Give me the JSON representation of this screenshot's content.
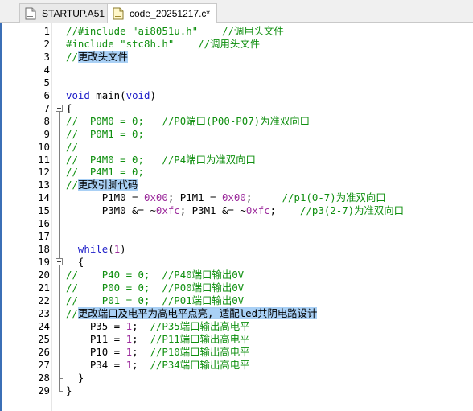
{
  "tabs": [
    {
      "label": "STARTUP.A51",
      "icon": "asm-file-icon",
      "active": false
    },
    {
      "label": "code_20251217.c*",
      "icon": "c-file-icon",
      "active": true
    }
  ],
  "lines": [
    {
      "n": "1",
      "code": "//#include \"ai8051u.h\"    //调用头文件"
    },
    {
      "n": "2",
      "code": "#include \"stc8h.h\"    //调用头文件"
    },
    {
      "n": "3",
      "code": "//更改头文件"
    },
    {
      "n": "4",
      "code": ""
    },
    {
      "n": "5",
      "code": ""
    },
    {
      "n": "6",
      "code": "void main(void)"
    },
    {
      "n": "7",
      "code": "{"
    },
    {
      "n": "8",
      "code": "//  P0M0 = 0;   //P0端口(P00-P07)为准双向口"
    },
    {
      "n": "9",
      "code": "//  P0M1 = 0;"
    },
    {
      "n": "10",
      "code": "//"
    },
    {
      "n": "11",
      "code": "//  P4M0 = 0;   //P4端口为准双向口"
    },
    {
      "n": "12",
      "code": "//  P4M1 = 0;"
    },
    {
      "n": "13",
      "code": "//更改引脚代码"
    },
    {
      "n": "14",
      "code": "      P1M0 = 0x00; P1M1 = 0x00;     //p1(0-7)为准双向口"
    },
    {
      "n": "15",
      "code": "      P3M0 &= ~0xfc; P3M1 &= ~0xfc;    //p3(2-7)为准双向口"
    },
    {
      "n": "16",
      "code": ""
    },
    {
      "n": "17",
      "code": ""
    },
    {
      "n": "18",
      "code": "  while(1)"
    },
    {
      "n": "19",
      "code": "  {"
    },
    {
      "n": "20",
      "code": "//    P40 = 0;  //P40端口输出0V"
    },
    {
      "n": "21",
      "code": "//    P00 = 0;  //P00端口输出0V"
    },
    {
      "n": "22",
      "code": "//    P01 = 0;  //P01端口输出0V"
    },
    {
      "n": "23",
      "code": "//更改端口及电平为高电平点亮, 适配led共阴电路设计"
    },
    {
      "n": "24",
      "code": "    P35 = 1;  //P35端口输出高电平"
    },
    {
      "n": "25",
      "code": "    P11 = 1;  //P11端口输出高电平"
    },
    {
      "n": "26",
      "code": "    P10 = 1;  //P10端口输出高电平"
    },
    {
      "n": "27",
      "code": "    P34 = 1;  //P34端口输出高电平"
    },
    {
      "n": "28",
      "code": "  }"
    },
    {
      "n": "29",
      "code": "}"
    }
  ],
  "colors": {
    "comment": "#0f8f0f",
    "keyword": "#1c1cc8",
    "number": "#9c2b9c",
    "selection": "#a9d0f5"
  }
}
